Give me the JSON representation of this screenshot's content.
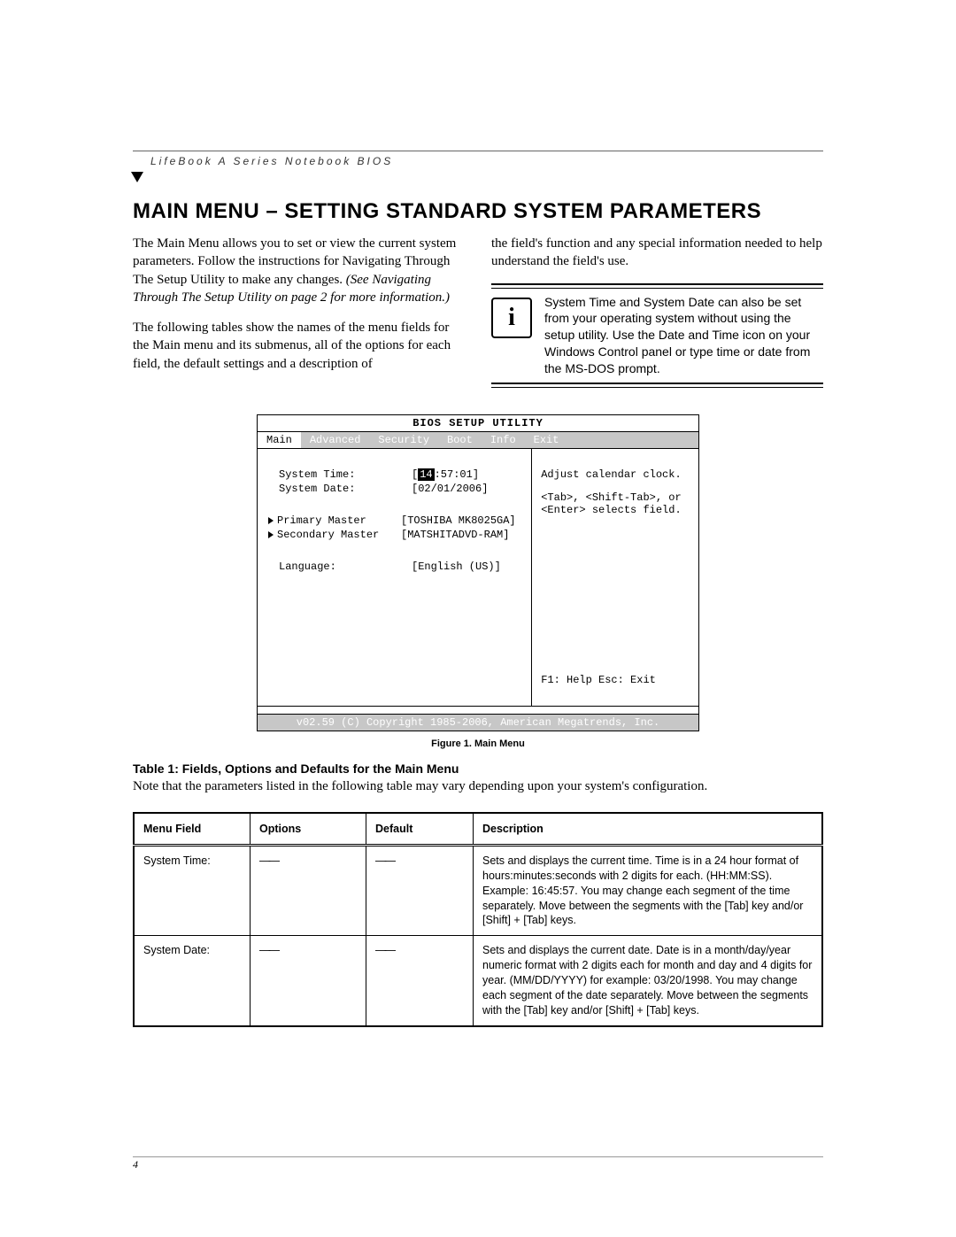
{
  "header_label": "LifeBook A Series Notebook BIOS",
  "title": "MAIN MENU – SETTING STANDARD SYSTEM PARAMETERS",
  "left_col": {
    "p1": "The Main Menu allows you to set or view the current system parameters. Follow the instructions for Navigating Through The Setup Utility to make any changes.",
    "p1_ital": "(See Navigating Through The Setup Utility on page 2 for more information.)",
    "p2": "The following tables show the names of the menu fields for the Main menu and its submenus, all of the options for each field, the default settings and a description of"
  },
  "right_col": {
    "p1": "the field's function and any special information needed to help understand the field's use."
  },
  "note": {
    "icon_glyph": "i",
    "text": "System Time and System Date can also be set from your operating system without using the setup utility. Use the Date and Time icon on your Windows Control panel or type time or date from the MS-DOS prompt."
  },
  "bios": {
    "title": "BIOS SETUP UTILITY",
    "tabs": [
      "Main",
      "Advanced",
      "Security",
      "Boot",
      "Info",
      "Exit"
    ],
    "active_tab_index": 0,
    "rows": {
      "time_label": "System Time:",
      "time_prefix": "[",
      "time_hl": "14",
      "time_suffix": ":57:01]",
      "date_label": "System Date:",
      "date_value": "[02/01/2006]",
      "pm_label": "Primary Master",
      "pm_value": "[TOSHIBA MK8025GA]",
      "sm_label": "Secondary Master",
      "sm_value": "[MATSHITADVD-RAM]",
      "lang_label": "Language:",
      "lang_value": "[English (US)]"
    },
    "help": {
      "l1": "Adjust calendar clock.",
      "l2": "<Tab>, <Shift-Tab>, or",
      "l3": "<Enter> selects field."
    },
    "footer_keys": "F1: Help   Esc: Exit",
    "copyright": "v02.59 (C) Copyright 1985-2006, American Megatrends, Inc."
  },
  "figure_caption": "Figure 1.   Main Menu",
  "table_title": "Table 1: Fields, Options and Defaults for the Main Menu",
  "table_note": "Note that the parameters listed in the following table may vary depending upon your system's configuration.",
  "table": {
    "headers": [
      "Menu Field",
      "Options",
      "Default",
      "Description"
    ],
    "rows": [
      {
        "field": "System Time:",
        "options": "——",
        "def": "——",
        "desc": "Sets and displays the current time. Time is in a 24 hour format of hours:minutes:seconds with 2 digits for each. (HH:MM:SS). Example: 16:45:57. You may change each segment of the time separately. Move between the segments with the [Tab] key and/or [Shift] + [Tab] keys."
      },
      {
        "field": "System Date:",
        "options": "——",
        "def": "——",
        "desc": "Sets and displays the current date. Date is in a month/day/year numeric format with 2 digits each for month and day and 4 digits for year. (MM/DD/YYYY) for example: 03/20/1998. You may change each segment of the date separately. Move between the segments with the [Tab] key and/or [Shift] + [Tab] keys."
      }
    ]
  },
  "page_number": "4"
}
